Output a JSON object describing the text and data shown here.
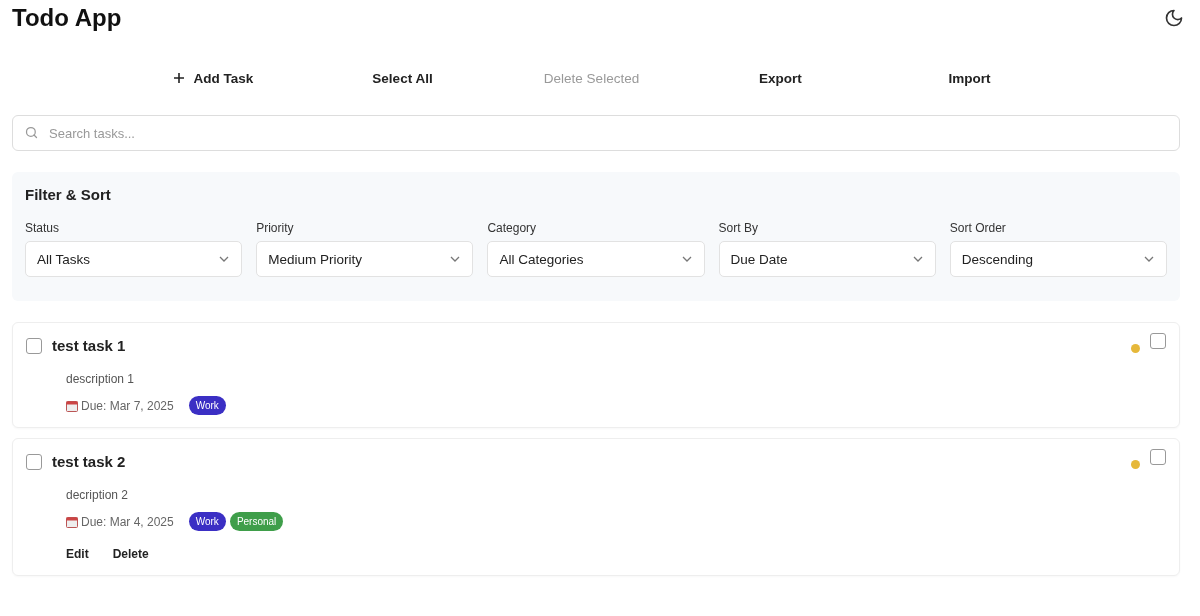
{
  "app_title": "Todo App",
  "toolbar": [
    {
      "label": "Add Task",
      "kind": "add",
      "disabled": false
    },
    {
      "label": "Select All",
      "kind": "plain",
      "disabled": false
    },
    {
      "label": "Delete Selected",
      "kind": "plain",
      "disabled": true
    },
    {
      "label": "Export",
      "kind": "plain",
      "disabled": false
    },
    {
      "label": "Import",
      "kind": "plain",
      "disabled": false
    }
  ],
  "search": {
    "placeholder": "Search tasks..."
  },
  "filter_panel": {
    "title": "Filter & Sort",
    "filters": [
      {
        "label": "Status",
        "value": "All Tasks"
      },
      {
        "label": "Priority",
        "value": "Medium Priority"
      },
      {
        "label": "Category",
        "value": "All Categories"
      },
      {
        "label": "Sort By",
        "value": "Due Date"
      },
      {
        "label": "Sort Order",
        "value": "Descending"
      }
    ]
  },
  "tasks": [
    {
      "title": "test task 1",
      "description": "description 1",
      "due": "Due: Mar 7, 2025",
      "done": false,
      "selected": false,
      "color": "#e6b83a",
      "tags": [
        {
          "label": "Work",
          "color": "#3b2fc4"
        }
      ]
    },
    {
      "title": "test task 2",
      "description": "decription 2",
      "due": "Due: Mar 4, 2025",
      "done": false,
      "selected": false,
      "color": "#e6b83a",
      "tags": [
        {
          "label": "Work",
          "color": "#3b2fc4"
        },
        {
          "label": "Personal",
          "color": "#3f9e4a"
        }
      ],
      "actions": [
        "Edit",
        "Delete"
      ]
    }
  ]
}
